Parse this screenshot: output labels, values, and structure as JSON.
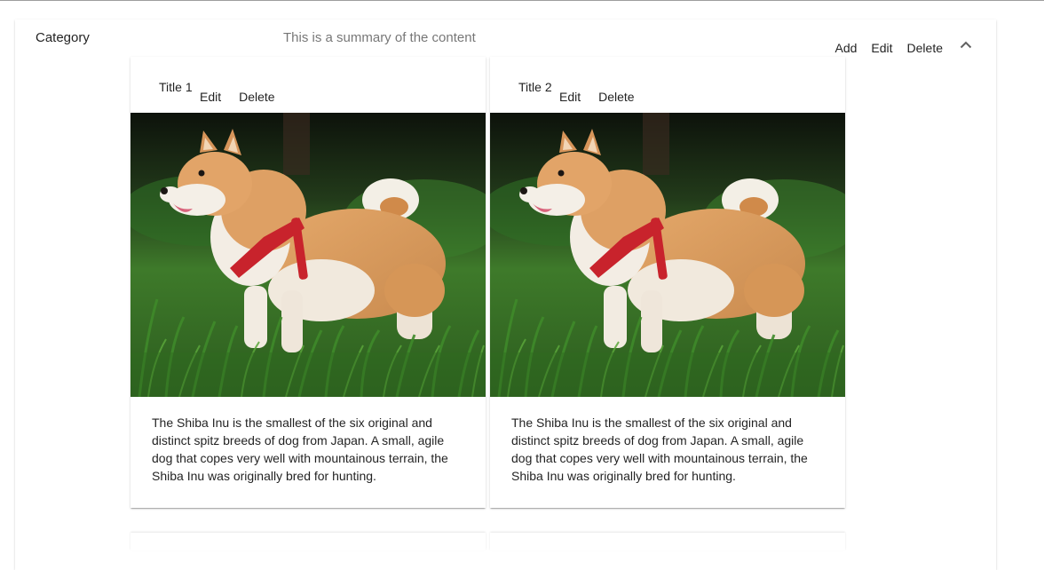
{
  "panel": {
    "category": "Category",
    "summary": "This is a summary of the content",
    "actions": {
      "add": "Add",
      "edit": "Edit",
      "delete": "Delete"
    },
    "expand_icon": "chevron-up-icon"
  },
  "cards": [
    {
      "title": "Title 1",
      "edit": "Edit",
      "delete": "Delete",
      "image": "shiba-inu-photo",
      "description": "The Shiba Inu is the smallest of the six original and distinct spitz breeds of dog from Japan. A small, agile dog that copes very well with mountainous terrain, the Shiba Inu was originally bred for hunting."
    },
    {
      "title": "Title 2",
      "edit": "Edit",
      "delete": "Delete",
      "image": "shiba-inu-photo",
      "description": "The Shiba Inu is the smallest of the six original and distinct spitz breeds of dog from Japan. A small, agile dog that copes very well with mountainous terrain, the Shiba Inu was originally bred for hunting."
    }
  ],
  "colors": {
    "text_primary": "#212121",
    "text_secondary": "#757575",
    "grass": "#3f7a2c",
    "fur": "#d89a5e",
    "harness": "#c8232c"
  }
}
